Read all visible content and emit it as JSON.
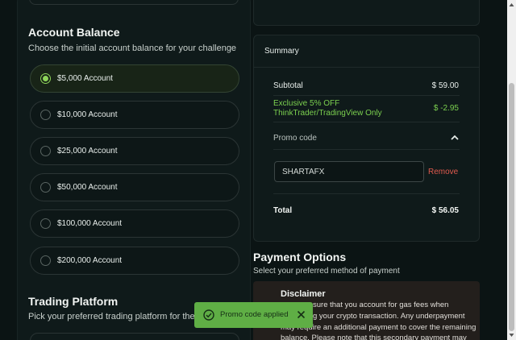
{
  "account": {
    "title": "Account Balance",
    "subtitle": "Choose the initial account balance for your challenge",
    "options": [
      {
        "label": "$5,000 Account",
        "selected": true
      },
      {
        "label": "$10,000 Account",
        "selected": false
      },
      {
        "label": "$25,000 Account",
        "selected": false
      },
      {
        "label": "$50,000 Account",
        "selected": false
      },
      {
        "label": "$100,000 Account",
        "selected": false
      },
      {
        "label": "$200,000 Account",
        "selected": false
      }
    ]
  },
  "trading": {
    "title": "Trading Platform",
    "subtitle": "Pick your preferred trading platform for the ch"
  },
  "summary": {
    "title": "Summary",
    "subtotal_label": "Subtotal",
    "subtotal_value": "$ 59.00",
    "discount_line1": "Exclusive 5% OFF",
    "discount_line2": "ThinkTrader/TradingView Only",
    "discount_value": "$ -2.95",
    "promo_label": "Promo code",
    "promo_value": "SHARTAFX",
    "remove_label": "Remove",
    "total_label": "Total",
    "total_value": "$ 56.05"
  },
  "payment": {
    "title": "Payment Options",
    "subtitle": "Select your preferred method of payment"
  },
  "disclaimer": {
    "title": "Disclaimer",
    "line1": "sure that you account for gas fees when",
    "line2": "g your crypto transaction. Any underpayment",
    "line3": "may require an additional payment to cover the remaining",
    "line4": "balance. Please note that this secondary payment may"
  },
  "toast": {
    "message": "Promo code applied"
  },
  "colors": {
    "accent_green": "#7bd04f",
    "remove_red": "#e05a4e",
    "toast_bg": "#5fae45"
  }
}
